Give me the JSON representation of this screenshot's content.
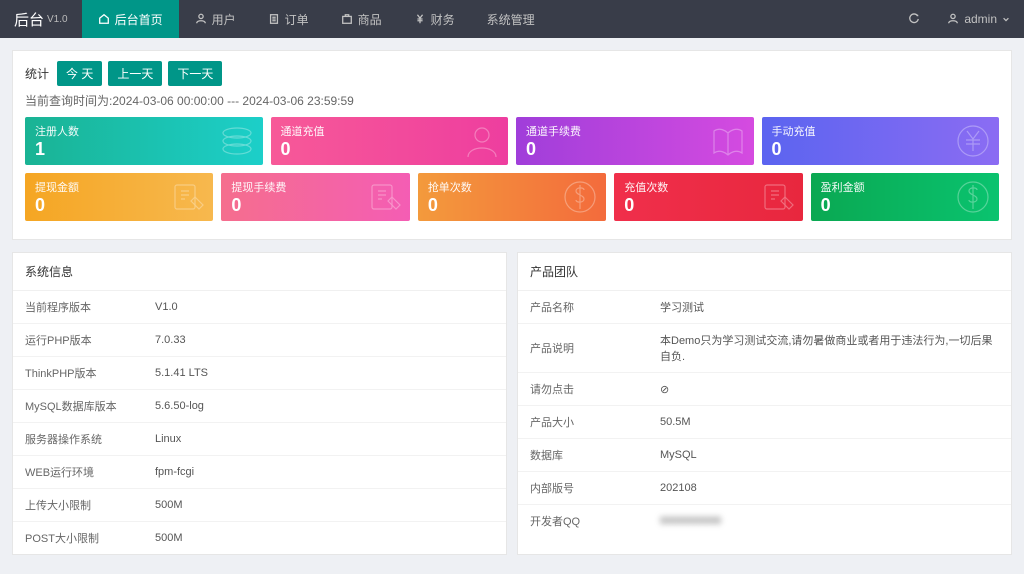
{
  "brand": {
    "name": "后台",
    "version": "V1.0"
  },
  "nav": {
    "items": [
      {
        "label": "后台首页",
        "icon": "home"
      },
      {
        "label": "用户",
        "icon": "user"
      },
      {
        "label": "订单",
        "icon": "order"
      },
      {
        "label": "商品",
        "icon": "goods"
      },
      {
        "label": "财务",
        "icon": "yen"
      },
      {
        "label": "系统管理",
        "icon": "none"
      }
    ],
    "active": 0
  },
  "user": {
    "name": "admin"
  },
  "stats": {
    "label": "统计",
    "buttons": [
      "今 天",
      "上一天",
      "下一天"
    ],
    "time_prefix": "当前查询时间为:",
    "time_range": "2024-03-06 00:00:00 --- 2024-03-06 23:59:59"
  },
  "cards_row1": [
    {
      "title": "注册人数",
      "value": "1",
      "cls": "c-cyan",
      "icon": "layers"
    },
    {
      "title": "通道充值",
      "value": "0",
      "cls": "c-pink",
      "icon": "person"
    },
    {
      "title": "通道手续费",
      "value": "0",
      "cls": "c-purple",
      "icon": "book"
    },
    {
      "title": "手动充值",
      "value": "0",
      "cls": "c-blue",
      "icon": "yen-circle"
    }
  ],
  "cards_row2": [
    {
      "title": "提现金额",
      "value": "0",
      "cls": "c-orange",
      "icon": "edit"
    },
    {
      "title": "提现手续费",
      "value": "0",
      "cls": "c-pink2",
      "icon": "edit"
    },
    {
      "title": "抢单次数",
      "value": "0",
      "cls": "c-orange2",
      "icon": "dollar"
    },
    {
      "title": "充值次数",
      "value": "0",
      "cls": "c-red",
      "icon": "edit"
    },
    {
      "title": "盈利金额",
      "value": "0",
      "cls": "c-green",
      "icon": "dollar"
    }
  ],
  "sysinfo": {
    "title": "系统信息",
    "rows": [
      {
        "k": "当前程序版本",
        "v": "V1.0"
      },
      {
        "k": "运行PHP版本",
        "v": "7.0.33"
      },
      {
        "k": "ThinkPHP版本",
        "v": "5.1.41 LTS"
      },
      {
        "k": "MySQL数据库版本",
        "v": "5.6.50-log"
      },
      {
        "k": "服务器操作系统",
        "v": "Linux"
      },
      {
        "k": "WEB运行环境",
        "v": "fpm-fcgi"
      },
      {
        "k": "上传大小限制",
        "v": "500M"
      },
      {
        "k": "POST大小限制",
        "v": "500M"
      }
    ]
  },
  "product": {
    "title": "产品团队",
    "rows": [
      {
        "k": "产品名称",
        "v": "学习测试"
      },
      {
        "k": "产品说明",
        "v": "本Demo只为学习测试交流,请勿暑做商业或者用于违法行为,一切后果自负."
      },
      {
        "k": "请勿点击",
        "v": "⊘"
      },
      {
        "k": "产品大小",
        "v": "50.5M"
      },
      {
        "k": "数据库",
        "v": "MySQL"
      },
      {
        "k": "内部版号",
        "v": "202108"
      },
      {
        "k": "开发者QQ",
        "v": "0000000000",
        "blur": true
      }
    ]
  }
}
